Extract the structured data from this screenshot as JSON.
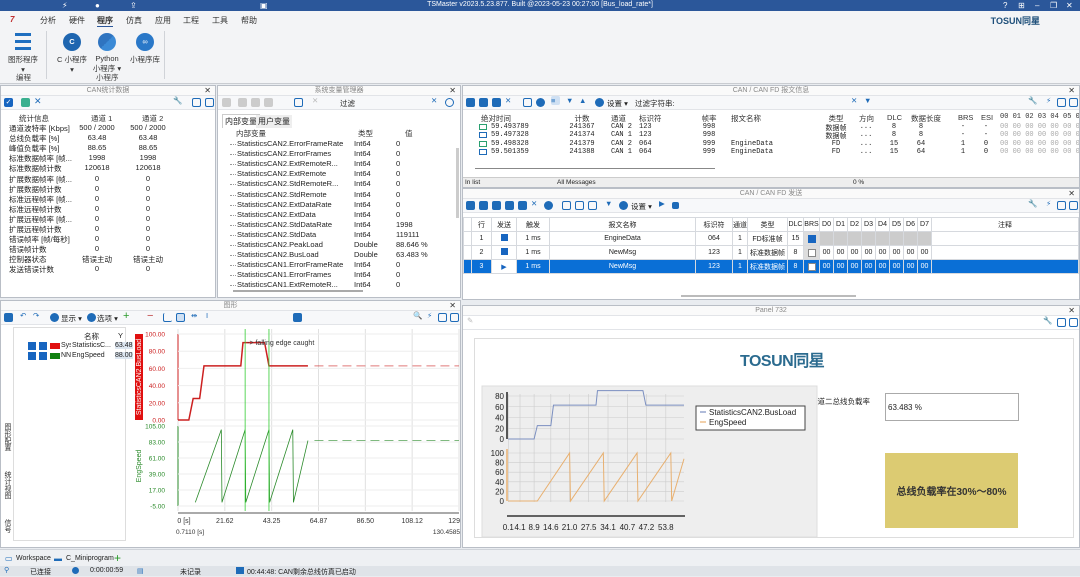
{
  "window": {
    "title": "TSMaster v2023.5.23.877. Built @2023-05-23 00:27:00 [Bus_load_rate*]",
    "brand": "TOSUN同星",
    "controls": [
      "?",
      "⊞",
      "–",
      "❐",
      "✕"
    ]
  },
  "menu": {
    "logo": "7",
    "items": [
      "分析",
      "硬件",
      "程序",
      "仿真",
      "应用",
      "工程",
      "工具",
      "帮助"
    ],
    "active": "程序"
  },
  "ribbon": {
    "buttons": {
      "graphic": "图形程序",
      "c": "C 小程序",
      "python1": "Python",
      "python2": "小程序",
      "lib": "小程序库"
    },
    "groups": {
      "g1": "编程",
      "g2": "小程序"
    }
  },
  "stats": {
    "title": "CAN统计数据",
    "header": [
      "统计信息",
      "通道 1",
      "通道 2"
    ],
    "rows": [
      [
        "通道波特率 [Kbps]",
        "500 / 2000",
        "500 / 2000"
      ],
      [
        "总线负载率 [%]",
        "63.48",
        "63.48"
      ],
      [
        "峰值负载率 [%]",
        "88.65",
        "88.65"
      ],
      [
        "标准数据帧率 [帧...",
        "1998",
        "1998"
      ],
      [
        "标准数据帧计数",
        "120618",
        "120618"
      ],
      [
        "扩展数据帧率 [帧...",
        "0",
        "0"
      ],
      [
        "扩展数据帧计数",
        "0",
        "0"
      ],
      [
        "标准远程帧率 [帧...",
        "0",
        "0"
      ],
      [
        "标准远程帧计数",
        "0",
        "0"
      ],
      [
        "扩展远程帧率 [帧...",
        "0",
        "0"
      ],
      [
        "扩展远程帧计数",
        "0",
        "0"
      ],
      [
        "错误帧率 [帧/每秒]",
        "0",
        "0"
      ],
      [
        "错误帧计数",
        "0",
        "0"
      ],
      [
        "控制器状态",
        "错误主动",
        "错误主动"
      ],
      [
        "发送错误计数",
        "0",
        "0"
      ]
    ]
  },
  "vars": {
    "title": "系统变量管理器",
    "filter_label": "过滤",
    "tabs": [
      "内部变量",
      "用户变量"
    ],
    "header": [
      "内部变量",
      "类型",
      "值"
    ],
    "rows": [
      [
        "StatisticsCAN2.ErrorFrameRate",
        "Int64",
        "0"
      ],
      [
        "StatisticsCAN2.ErrorFrames",
        "Int64",
        "0"
      ],
      [
        "StatisticsCAN2.ExtRemoteR...",
        "Int64",
        "0"
      ],
      [
        "StatisticsCAN2.ExtRemote",
        "Int64",
        "0"
      ],
      [
        "StatisticsCAN2.StdRemoteR...",
        "Int64",
        "0"
      ],
      [
        "StatisticsCAN2.StdRemote",
        "Int64",
        "0"
      ],
      [
        "StatisticsCAN2.ExtDataRate",
        "Int64",
        "0"
      ],
      [
        "StatisticsCAN2.ExtData",
        "Int64",
        "0"
      ],
      [
        "StatisticsCAN2.StdDataRate",
        "Int64",
        "1998"
      ],
      [
        "StatisticsCAN2.StdData",
        "Int64",
        "119111"
      ],
      [
        "StatisticsCAN2.PeakLoad",
        "Double",
        "88.646 %"
      ],
      [
        "StatisticsCAN2.BusLoad",
        "Double",
        "63.483 %"
      ],
      [
        "StatisticsCAN1.ErrorFrameRate",
        "Int64",
        "0"
      ],
      [
        "StatisticsCAN1.ErrorFrames",
        "Int64",
        "0"
      ],
      [
        "StatisticsCAN1.ExtRemoteR...",
        "Int64",
        "0"
      ]
    ]
  },
  "msgs": {
    "title": "CAN / CAN FD 报文信息",
    "settings": "设置",
    "filter_label": "过滤字符串:",
    "header": [
      "绝对时间",
      "计数",
      "通道",
      "标识符",
      "帧率",
      "报文名称",
      "类型",
      "方向",
      "DLC",
      "数据长度",
      "BRS",
      "ESI",
      "00 01 02 03 04 05 06"
    ],
    "rows": [
      [
        "59.493789",
        "241367",
        "CAN 2",
        "123",
        "998",
        "",
        "数据帧",
        "...",
        "8",
        "8",
        "-",
        "-",
        "00 00 00 00 00 00 00"
      ],
      [
        "59.497328",
        "241374",
        "CAN 1",
        "123",
        "998",
        "",
        "数据帧",
        "...",
        "8",
        "8",
        "-",
        "-",
        "00 00 00 00 00 00 00"
      ],
      [
        "59.498328",
        "241379",
        "CAN 2",
        "064",
        "999",
        "EngineData",
        "FD",
        "...",
        "15",
        "64",
        "1",
        "0",
        "00 00 00 00 00 00 00"
      ],
      [
        "59.501359",
        "241388",
        "CAN 1",
        "064",
        "999",
        "EngineData",
        "FD",
        "...",
        "15",
        "64",
        "1",
        "0",
        "00 00 00 00 00 00 00"
      ]
    ],
    "status": [
      "In list",
      "All Messages",
      "0 %"
    ]
  },
  "send": {
    "title": "CAN / CAN FD 发送",
    "settings": "设置",
    "header": [
      "",
      "行",
      "发送",
      "触发",
      "报文名称",
      "标识符",
      "通道",
      "类型",
      "DLC",
      "BRS",
      "D0",
      "D1",
      "D2",
      "D3",
      "D4",
      "D5",
      "D6",
      "D7",
      "注释"
    ],
    "rows": [
      {
        "row": "1",
        "send": "stop",
        "trigger": "1 ms",
        "name": "EngineData",
        "id": "064",
        "ch": "1",
        "type": "FD标准帧",
        "dlc": "15",
        "brs": true,
        "data": []
      },
      {
        "row": "2",
        "send": "stop",
        "trigger": "1 ms",
        "name": "NewMsg",
        "id": "123",
        "ch": "1",
        "type": "标准数据帧",
        "dlc": "8",
        "brs": false,
        "data": [
          "00",
          "00",
          "00",
          "00",
          "00",
          "00",
          "00",
          "00"
        ]
      },
      {
        "row": "3",
        "send": "play",
        "trigger": "1 ms",
        "name": "NewMsg",
        "id": "123",
        "ch": "1",
        "type": "标准数据帧",
        "dlc": "8",
        "brs": false,
        "data": [
          "00",
          "00",
          "00",
          "00",
          "00",
          "00",
          "00",
          "00"
        ],
        "selected": true
      }
    ]
  },
  "graph": {
    "title": "图形",
    "display": "显示",
    "options": "选项",
    "legend_header": [
      "名称",
      "Y"
    ],
    "legend": [
      {
        "short": "Sys",
        "name": "StatisticsC...",
        "y": "63.48",
        "color": "#e01010"
      },
      {
        "short": "NN",
        "name": "EngSpeed",
        "y": "88.00",
        "color": "#108010"
      }
    ],
    "side_tabs": [
      "图形配置",
      "统计视图",
      "信号"
    ],
    "cursor_left": "0.7110 [s]",
    "cursor_right": "130.4585",
    "annotation": "-> falling edge caught"
  },
  "panel": {
    "title": "Panel 732",
    "logo": "TOSUN同星",
    "load_label": "通道二总线负载率",
    "load_value": "63.483 %",
    "indicator_text": "总线负载率在30%～80%",
    "indicator_color": "#dccb72"
  },
  "chart_data": [
    {
      "type": "line",
      "xlim": [
        0,
        129.75
      ],
      "xticks": [
        "0 [s]",
        "21.62",
        "43.25",
        "64.87",
        "86.50",
        "108.12",
        "129.75"
      ],
      "xtick_values": [
        0,
        21.62,
        43.25,
        64.87,
        86.5,
        108.12,
        129.75
      ],
      "grid": true,
      "series": [
        {
          "name": "StatisticsCAN2.BusLoad",
          "color": "#cc2020",
          "ylim": [
            0,
            100
          ],
          "yticks": [
            "100.00",
            "80.00",
            "60.00",
            "40.00",
            "20.00",
            "0.00"
          ],
          "x": [
            0,
            5,
            7,
            10,
            12,
            29,
            30,
            40,
            42,
            60
          ],
          "y": [
            0,
            0,
            25,
            25,
            63,
            63,
            90,
            90,
            63,
            63
          ]
        },
        {
          "name": "EngSpeed",
          "color": "#2a8a2a",
          "ylim": [
            -5,
            105
          ],
          "yticks": [
            "105.00",
            "83.00",
            "61.00",
            "39.00",
            "17.00",
            "-5.00"
          ],
          "x": [
            8,
            20,
            20.3,
            31,
            31.3,
            42,
            42.3,
            53,
            53.3,
            60
          ],
          "y": [
            0,
            100,
            0,
            100,
            0,
            100,
            0,
            100,
            0,
            85
          ]
        }
      ],
      "cursors": [
        31,
        42
      ]
    },
    {
      "type": "line",
      "xticks": [
        "0.1",
        "4.1",
        "8.9",
        "14.6",
        "21.0",
        "27.5",
        "34.1",
        "40.7",
        "47.2",
        "53.8"
      ],
      "xlim": [
        0,
        60
      ],
      "grid": true,
      "legend": "right",
      "series": [
        {
          "name": "StatisticsCAN2.BusLoad",
          "color": "#7b8fc0",
          "ylim": [
            0,
            80
          ],
          "yticks": [
            "80",
            "60",
            "40",
            "20",
            "0"
          ],
          "x": [
            0.1,
            8.9,
            10,
            14.6,
            15.5,
            30,
            30.5,
            46,
            47,
            60
          ],
          "y": [
            0,
            0,
            25,
            25,
            63,
            63,
            90,
            90,
            63,
            63
          ]
        },
        {
          "name": "EngSpeed",
          "color": "#e8b070",
          "ylim": [
            0,
            100
          ],
          "yticks": [
            "100",
            "80",
            "60",
            "40",
            "20",
            "0"
          ],
          "x": [
            0.1,
            10,
            21,
            21.3,
            32.5,
            32.8,
            44,
            44.3,
            55.5,
            55.8,
            60
          ],
          "y": [
            0,
            0,
            100,
            0,
            100,
            0,
            100,
            0,
            100,
            0,
            88
          ]
        }
      ]
    }
  ],
  "tabs": {
    "items": [
      "Workspace",
      "C_Miniprogram"
    ],
    "add": "+"
  },
  "status": {
    "connection": "已连接",
    "time": "0:00:00:59",
    "record": "未记录",
    "message": "00:44:48: CAN剩余总线仿真已启动"
  }
}
